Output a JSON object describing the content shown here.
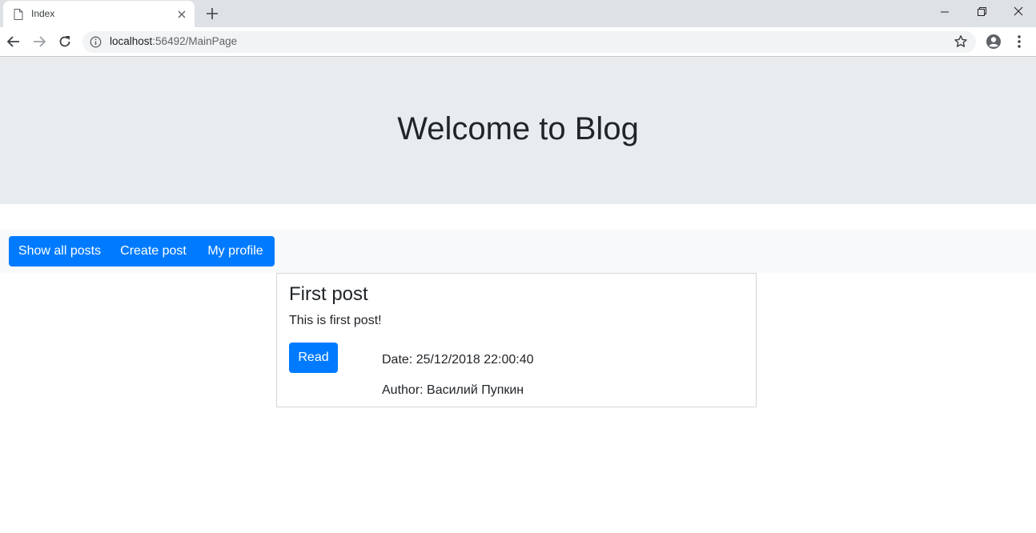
{
  "browser": {
    "tab_title": "Index",
    "url_host": "localhost",
    "url_path": ":56492/MainPage"
  },
  "page": {
    "jumbotron_title": "Welcome to Blog",
    "nav": {
      "show_all_posts": "Show all posts",
      "create_post": "Create post",
      "my_profile": "My profile"
    },
    "posts": [
      {
        "title": "First post",
        "text": "This is first post!",
        "read_label": "Read",
        "date": "Date: 25/12/2018 22:00:40",
        "author": "Author: Василий Пупкин"
      }
    ]
  },
  "colors": {
    "primary": "#007bff",
    "jumbotron_bg": "#e9ecef",
    "navbar_bg": "#f8f9fa"
  }
}
